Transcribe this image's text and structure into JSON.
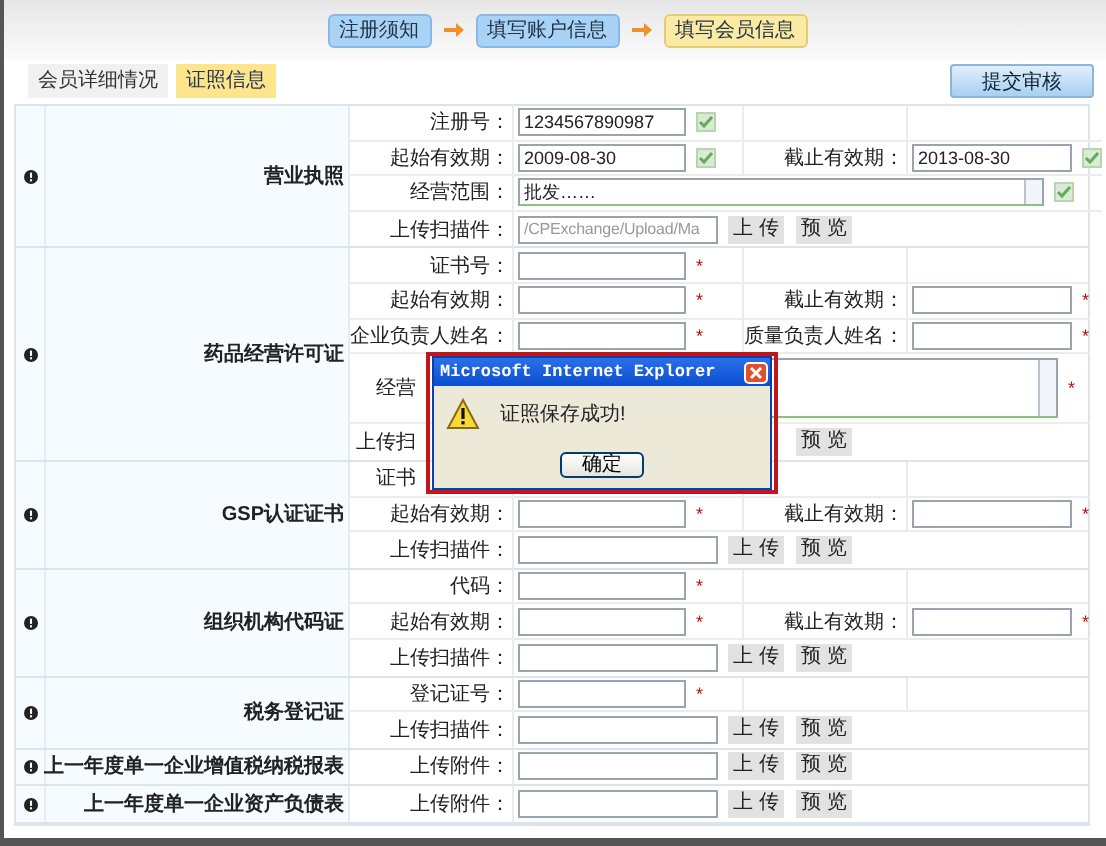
{
  "steps": [
    {
      "label": "注册须知",
      "selected": false
    },
    {
      "label": "填写账户信息",
      "selected": false
    },
    {
      "label": "填写会员信息",
      "selected": true
    }
  ],
  "tabs": [
    {
      "label": "会员详细情况",
      "selected": false
    },
    {
      "label": "证照信息",
      "selected": true
    }
  ],
  "submit_button": "提交审核",
  "sections": [
    {
      "title": "营业执照",
      "rows": [
        {
          "kind": "pair",
          "covered": false,
          "label": "注册号：",
          "field": {
            "kind": "input",
            "value": "1234567890987"
          },
          "mark": {
            "kind": "check"
          }
        },
        {
          "kind": "pair",
          "covered": false,
          "label": "起始有效期：",
          "field": {
            "kind": "input",
            "value": "2009-08-30"
          },
          "mark": {
            "kind": "check"
          },
          "label2": "截止有效期：",
          "field2": {
            "kind": "input",
            "value": "2013-08-30"
          },
          "mark2": {
            "kind": "check"
          }
        },
        {
          "kind": "textarea",
          "covered": false,
          "label": "经营范围：",
          "field": {
            "kind": "textarea",
            "value": "批发……"
          },
          "mark": {
            "kind": "check"
          }
        },
        {
          "kind": "upload",
          "covered": false,
          "label": "上传扫描件：",
          "field": {
            "kind": "input",
            "value": "/CPExchange/Upload/Ma",
            "disabled": true
          },
          "buttons": [
            {
              "kind": "upload",
              "label": "上 传"
            },
            {
              "kind": "preview",
              "label": "预 览"
            }
          ]
        }
      ]
    },
    {
      "title": "药品经营许可证",
      "rows": [
        {
          "kind": "pair",
          "covered": false,
          "label": "证书号：",
          "field": {
            "kind": "input"
          },
          "mark": {
            "kind": "required",
            "text": "*"
          }
        },
        {
          "kind": "pair",
          "covered": false,
          "label": "起始有效期：",
          "field": {
            "kind": "input"
          },
          "mark": {
            "kind": "required",
            "text": "*"
          },
          "label2": "截止有效期：",
          "field2": {
            "kind": "input"
          },
          "mark2": {
            "kind": "required",
            "text": "*"
          }
        },
        {
          "kind": "pair",
          "covered": false,
          "label": "企业负责人姓名：",
          "field": {
            "kind": "input"
          },
          "mark": {
            "kind": "required",
            "text": "*"
          },
          "label2": "质量负责人姓名：",
          "field2": {
            "kind": "input"
          },
          "mark2": {
            "kind": "required",
            "text": "*"
          }
        },
        {
          "kind": "memo",
          "covered": true,
          "label": "经营",
          "field": {
            "kind": "textarea"
          },
          "mark": {
            "kind": "required",
            "text": "*"
          }
        },
        {
          "kind": "upload",
          "covered": true,
          "label": "上传扫",
          "buttons": [
            {
              "kind": "preview",
              "label": "预 览"
            }
          ]
        }
      ]
    },
    {
      "title": "GSP认证证书",
      "rows": [
        {
          "kind": "pair",
          "covered": true,
          "label": "证书"
        },
        {
          "kind": "pair",
          "covered": false,
          "label": "起始有效期：",
          "field": {
            "kind": "input"
          },
          "mark": {
            "kind": "required",
            "text": "*"
          },
          "label2": "截止有效期：",
          "field2": {
            "kind": "input"
          },
          "mark2": {
            "kind": "required",
            "text": "*"
          }
        },
        {
          "kind": "upload",
          "covered": false,
          "label": "上传扫描件：",
          "field": {
            "kind": "input"
          },
          "buttons": [
            {
              "kind": "upload",
              "label": "上 传"
            },
            {
              "kind": "preview",
              "label": "预 览"
            }
          ]
        }
      ]
    },
    {
      "title": "组织机构代码证",
      "rows": [
        {
          "kind": "pair",
          "covered": false,
          "label": "代码：",
          "field": {
            "kind": "input"
          },
          "mark": {
            "kind": "required",
            "text": "*"
          }
        },
        {
          "kind": "pair",
          "covered": false,
          "label": "起始有效期：",
          "field": {
            "kind": "input"
          },
          "mark": {
            "kind": "required",
            "text": "*"
          },
          "label2": "截止有效期：",
          "field2": {
            "kind": "input"
          },
          "mark2": {
            "kind": "required",
            "text": "*"
          }
        },
        {
          "kind": "upload",
          "covered": false,
          "label": "上传扫描件：",
          "field": {
            "kind": "input"
          },
          "buttons": [
            {
              "kind": "upload",
              "label": "上 传"
            },
            {
              "kind": "preview",
              "label": "预 览"
            }
          ]
        }
      ]
    },
    {
      "title": "税务登记证",
      "rows": [
        {
          "kind": "pair",
          "covered": false,
          "label": "登记证号：",
          "field": {
            "kind": "input"
          },
          "mark": {
            "kind": "required",
            "text": "*"
          }
        },
        {
          "kind": "upload",
          "covered": false,
          "label": "上传扫描件：",
          "field": {
            "kind": "input"
          },
          "buttons": [
            {
              "kind": "upload",
              "label": "上 传"
            },
            {
              "kind": "preview",
              "label": "预 览"
            }
          ]
        }
      ]
    },
    {
      "title": "上一年度单一企业增值税纳税报表",
      "rows": [
        {
          "kind": "upload",
          "covered": false,
          "label": "上传附件：",
          "field": {
            "kind": "input"
          },
          "buttons": [
            {
              "kind": "upload",
              "label": "上 传"
            },
            {
              "kind": "preview",
              "label": "预 览"
            }
          ]
        }
      ]
    },
    {
      "title": "上一年度单一企业资产负债表",
      "rows": [
        {
          "kind": "upload",
          "covered": false,
          "label": "上传附件：",
          "field": {
            "kind": "input"
          },
          "buttons": [
            {
              "kind": "upload",
              "label": "上 传"
            },
            {
              "kind": "preview",
              "label": "预 览"
            }
          ]
        }
      ]
    }
  ],
  "dialog": {
    "title": "Microsoft Internet Explorer",
    "message": "证照保存成功!",
    "button": "确定"
  }
}
